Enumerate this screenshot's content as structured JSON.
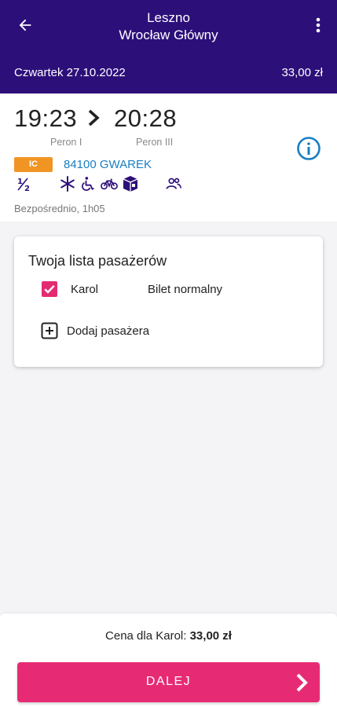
{
  "header": {
    "from": "Leszno",
    "to": "Wrocław Główny",
    "date": "Czwartek 27.10.2022",
    "price": "33,00 zł"
  },
  "trip": {
    "departure_time": "19:23",
    "arrival_time": "20:28",
    "departure_platform": "Peron I",
    "arrival_platform": "Peron III",
    "category": "IC",
    "train_number": "84100 GWAREK",
    "amenities": [
      "half-class-icon",
      "air-conditioning-icon",
      "wheelchair-icon",
      "bicycle-icon",
      "baggage-icon",
      "passengers-icon"
    ],
    "connection": "Bezpośrednio, 1h05"
  },
  "passengers": {
    "title": "Twoja lista pasażerów",
    "items": [
      {
        "name": "Karol",
        "ticket": "Bilet normalny",
        "checked": true
      }
    ],
    "add_label": "Dodaj pasażera"
  },
  "footer": {
    "price_prefix": "Cena dla Karol: ",
    "price_value": "33,00 zł",
    "next_label": "DALEJ"
  },
  "colors": {
    "header_bg": "#2d0f7a",
    "accent": "#e62b74",
    "ic_badge": "#f09524",
    "link": "#1a7fc1"
  }
}
